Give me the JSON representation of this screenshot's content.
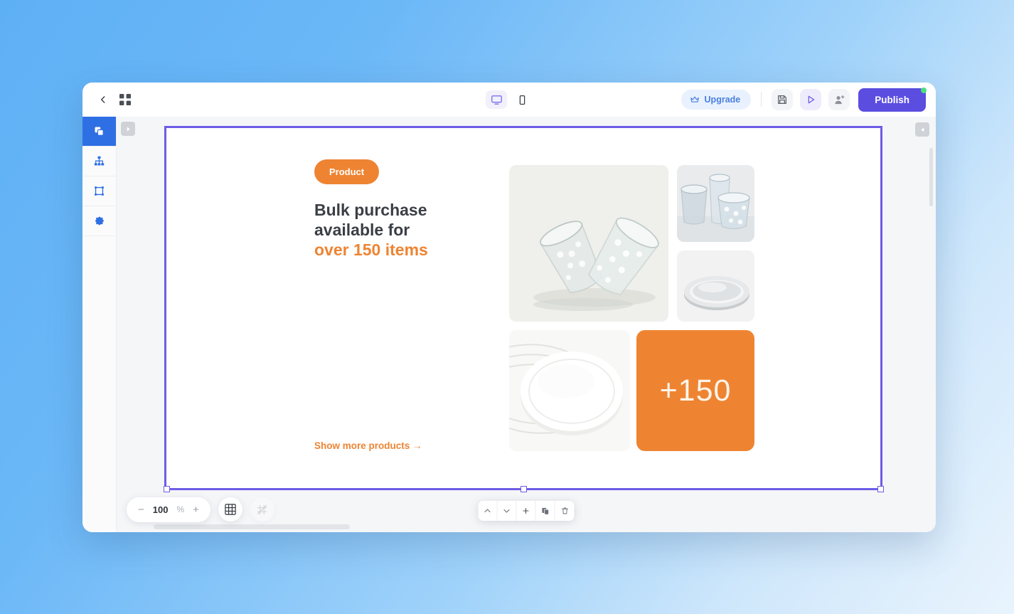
{
  "app": {
    "topbar": {
      "back_icon": "chevron-left-icon",
      "apps_icon": "grid-apps-icon",
      "devices": [
        {
          "name": "desktop",
          "icon": "monitor-icon",
          "active": true
        },
        {
          "name": "mobile",
          "icon": "mobile-phone-icon",
          "active": false
        }
      ],
      "upgrade_label": "Upgrade",
      "upgrade_icon": "crown-icon",
      "save_icon": "floppy-save-icon",
      "preview_icon": "play-preview-icon",
      "invite_icon": "add-user-icon",
      "publish_label": "Publish",
      "publish_has_notification_dot": true
    },
    "left_rail": [
      {
        "name": "layers",
        "icon": "layers-icon",
        "active": true
      },
      {
        "name": "sitemap",
        "icon": "sitemap-icon",
        "active": false
      },
      {
        "name": "frame",
        "icon": "frame-crop-icon",
        "active": false
      },
      {
        "name": "settings",
        "icon": "gear-icon",
        "active": false
      }
    ],
    "panel_toggles": {
      "left_icon": "expand-right-icon",
      "right_icon": "collapse-left-icon"
    },
    "bottom": {
      "zoom_minus": "−",
      "zoom_value": "100",
      "zoom_unit": "%",
      "zoom_plus": "+",
      "grid_icon": "grid-toggle-icon",
      "snap_icon": "snap-off-icon",
      "element_toolbar": [
        {
          "name": "move-up",
          "icon": "chevron-up-icon"
        },
        {
          "name": "move-down",
          "icon": "chevron-down-icon"
        },
        {
          "name": "add-section",
          "icon": "plus-icon"
        },
        {
          "name": "duplicate",
          "icon": "duplicate-icon"
        },
        {
          "name": "delete",
          "icon": "trash-icon"
        }
      ]
    }
  },
  "canvas": {
    "badge": "Product",
    "headline_line1": "Bulk purchase",
    "headline_line2": "available for",
    "headline_accent": "over 150 items",
    "link": "Show more products →",
    "count_tile": "+150",
    "images": [
      {
        "name": "drinking-glasses-large",
        "alt": "two tilted textured drinking glasses"
      },
      {
        "name": "water-glasses",
        "alt": "glasses filled with water"
      },
      {
        "name": "silver-tray",
        "alt": "round silver serving tray"
      },
      {
        "name": "white-plates",
        "alt": "stack of white dinner plates"
      }
    ]
  },
  "colors": {
    "accent_orange": "#ee8432",
    "brand_purple": "#5b4de0",
    "selection_purple": "#6c5ce7",
    "rail_active_blue": "#2f6fe4",
    "upgrade_blue": "#4a7fe0",
    "notification_green": "#4ade80"
  }
}
